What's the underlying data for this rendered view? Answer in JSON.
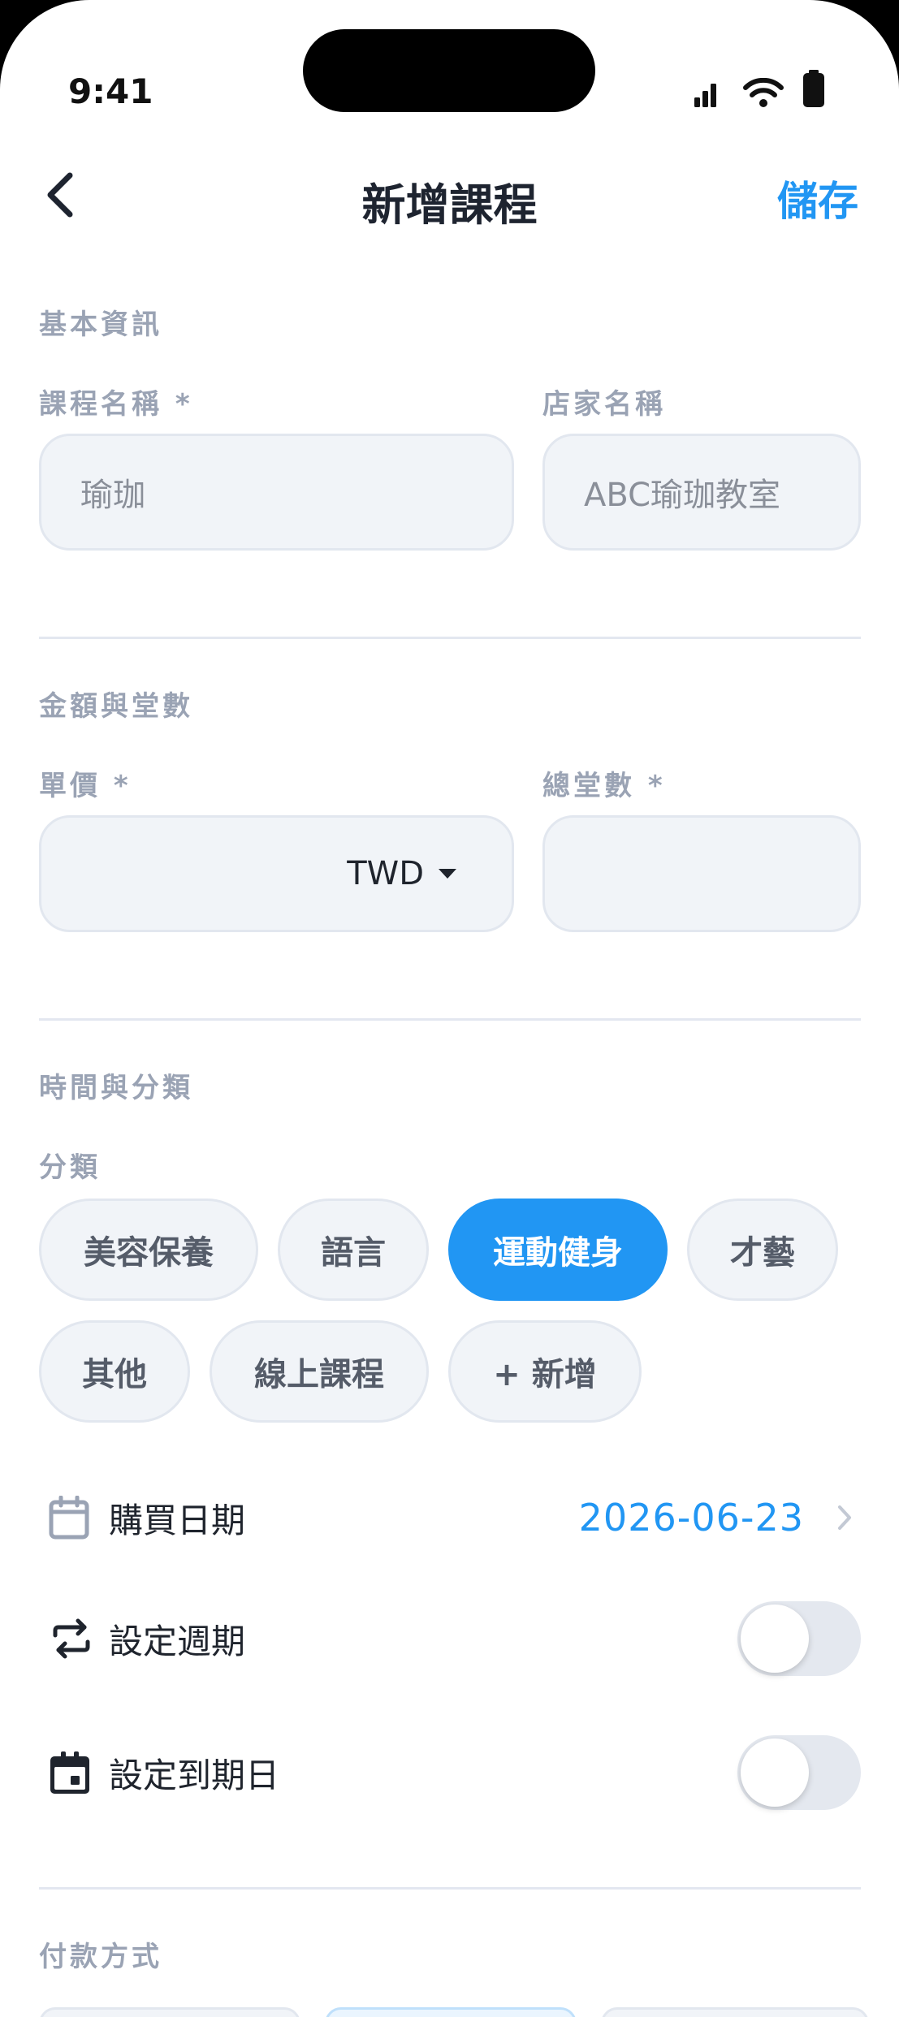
{
  "status_bar": {
    "time": "9:41"
  },
  "nav": {
    "title": "新增課程",
    "save_label": "儲存"
  },
  "basic_info": {
    "section_label": "基本資訊",
    "course_name_label": "課程名稱 *",
    "course_name_placeholder": "瑜珈",
    "store_name_label": "店家名稱",
    "store_name_placeholder": "ABC瑜珈教室"
  },
  "amount": {
    "section_label": "金額與堂數",
    "unit_price_label": "單價 *",
    "unit_price_value": "",
    "currency": "TWD",
    "total_sessions_label": "總堂數 *",
    "total_sessions_value": ""
  },
  "time_category": {
    "section_label": "時間與分類",
    "category_label": "分類",
    "categories": [
      "美容保養",
      "語言",
      "運動健身",
      "才藝",
      "其他",
      "線上課程",
      "+ 新增"
    ],
    "selected_category": "運動健身",
    "purchase_date_label": "購買日期",
    "purchase_date_value": "2026-06-23",
    "recurring_label": "設定週期",
    "recurring_on": false,
    "expiry_label": "設定到期日",
    "expiry_on": false
  },
  "payment": {
    "section_label": "付款方式"
  },
  "colors": {
    "accent": "#2196F3",
    "muted": "#9aa3b4",
    "field_bg": "#f1f4f8"
  }
}
